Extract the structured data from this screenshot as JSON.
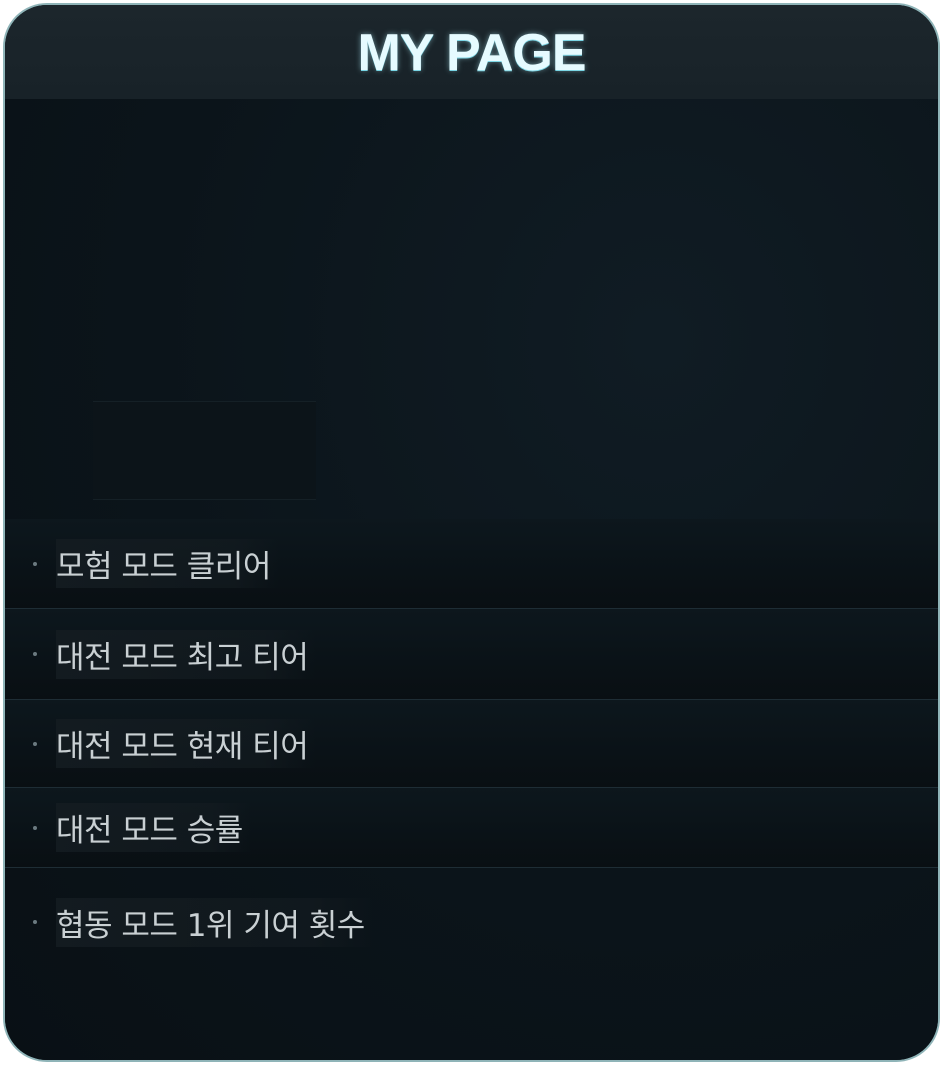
{
  "header": {
    "title": "MY PAGE"
  },
  "stats": [
    {
      "label": "모험 모드 클리어"
    },
    {
      "label": "대전 모드 최고 티어"
    },
    {
      "label": "대전 모드 현재 티어"
    },
    {
      "label": "대전 모드 승률"
    },
    {
      "label": "협동 모드 1위 기여 횟수"
    }
  ],
  "colors": {
    "panel_border": "#8fb4b8",
    "panel_background": "#0a1218",
    "title_text": "#e6fbff",
    "label_text": "#c9d0d3"
  }
}
